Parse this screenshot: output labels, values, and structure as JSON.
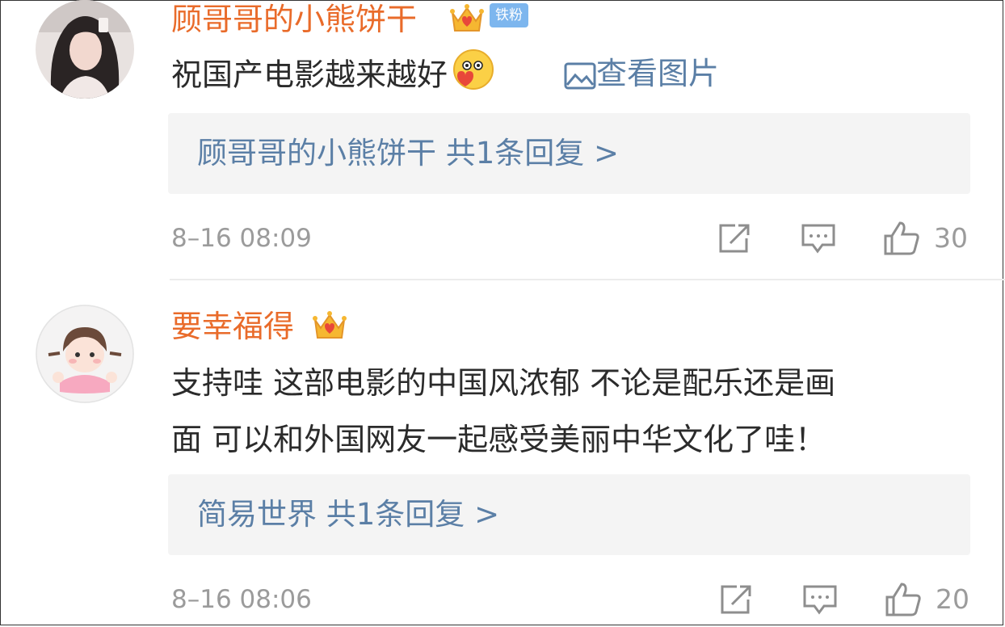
{
  "colors": {
    "username": "#e96b2a",
    "link": "#5b7fa6",
    "text": "#2b2b2b",
    "meta": "#9b9b9b",
    "reply_bg": "#f4f4f4",
    "fan_badge": "#7db6ee"
  },
  "comments": [
    {
      "username": "顾哥哥的小熊饼干",
      "badges": [
        "crown-icon",
        "fan-badge"
      ],
      "fan_badge_label": "铁粉",
      "text": "祝国产电影越来越好",
      "emoji": "kiss-emoji",
      "view_pic_label": "查看图片",
      "reply_preview": "顾哥哥的小熊饼干  共1条回复 >",
      "timestamp": "8–16 08:09",
      "likes": "30"
    },
    {
      "username": "要幸福得",
      "badges": [
        "crown-icon"
      ],
      "text_line1": "支持哇 这部电影的中国风浓郁 不论是配乐还是画",
      "text_line2": "面 可以和外国网友一起感受美丽中华文化了哇！",
      "reply_preview": "简易世界  共1条回复 >",
      "timestamp": "8–16 08:06",
      "likes": "20"
    }
  ]
}
